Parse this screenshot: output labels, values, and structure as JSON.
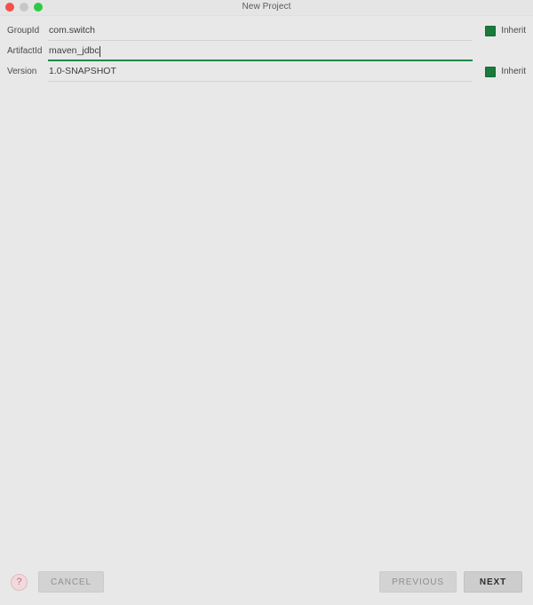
{
  "window": {
    "title": "New Project",
    "traffic_lights": [
      {
        "name": "close",
        "color": "#f4514a"
      },
      {
        "name": "minimize",
        "color": "#c7c7c7"
      },
      {
        "name": "zoom",
        "color": "#2ecb42"
      }
    ]
  },
  "form": {
    "rows": [
      {
        "label": "GroupId",
        "value": "com.switch",
        "focused": false,
        "inherit": {
          "label": "Inherit",
          "checked": true
        }
      },
      {
        "label": "ArtifactId",
        "value": "maven_jdbc",
        "focused": true,
        "inherit": null
      },
      {
        "label": "Version",
        "value": "1.0-SNAPSHOT",
        "focused": false,
        "inherit": {
          "label": "Inherit",
          "checked": true
        }
      }
    ]
  },
  "footer": {
    "help_label": "?",
    "cancel_label": "CANCEL",
    "previous_label": "PREVIOUS",
    "next_label": "NEXT"
  },
  "colors": {
    "accent_green": "#1a7a3c",
    "focus_underline": "#1d8a46",
    "background": "#e8e8e8",
    "underline": "#d3d3d3",
    "help_icon": "#c8687a"
  }
}
